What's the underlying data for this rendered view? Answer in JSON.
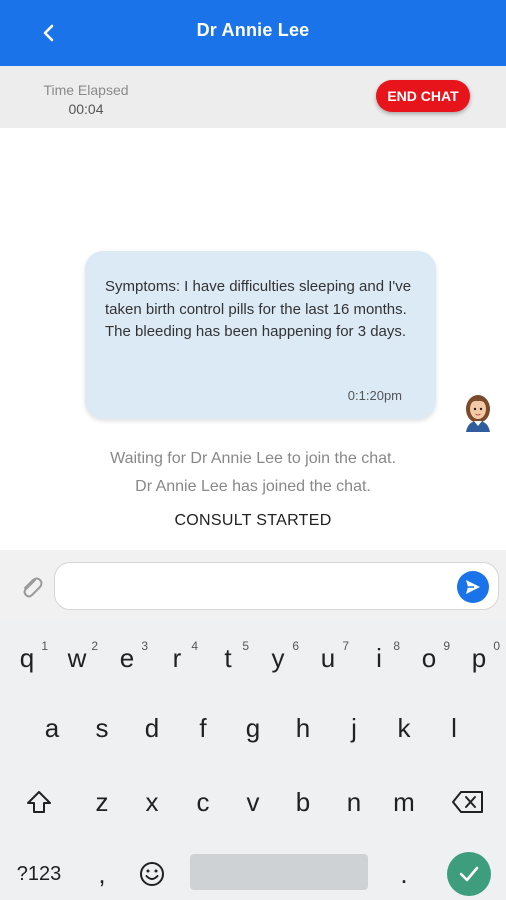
{
  "header": {
    "title": "Dr Annie Lee"
  },
  "timer": {
    "label": "Time Elapsed",
    "value": "00:04",
    "end_chat_label": "END CHAT"
  },
  "chat": {
    "bubble_text": "Symptoms: I have difficulties sleeping and I've taken birth control pills for the last 16 months. The bleeding has been happening for 3 days.",
    "bubble_time": "0:1:20pm",
    "system_messages": [
      "Waiting for Dr Annie Lee to join the chat.",
      "Dr Annie Lee has joined the chat."
    ],
    "consult_status": "CONSULT STARTED"
  },
  "input": {
    "value": "",
    "placeholder": ""
  },
  "keyboard": {
    "row1": [
      {
        "key": "q",
        "hint": "1"
      },
      {
        "key": "w",
        "hint": "2"
      },
      {
        "key": "e",
        "hint": "3"
      },
      {
        "key": "r",
        "hint": "4"
      },
      {
        "key": "t",
        "hint": "5"
      },
      {
        "key": "y",
        "hint": "6"
      },
      {
        "key": "u",
        "hint": "7"
      },
      {
        "key": "i",
        "hint": "8"
      },
      {
        "key": "o",
        "hint": "9"
      },
      {
        "key": "p",
        "hint": "0"
      }
    ],
    "row2": [
      "a",
      "s",
      "d",
      "f",
      "g",
      "h",
      "j",
      "k",
      "l"
    ],
    "row3": [
      "z",
      "x",
      "c",
      "v",
      "b",
      "n",
      "m"
    ],
    "symbols_label": "?123",
    "comma": ",",
    "period": "."
  },
  "colors": {
    "header": "#1a73e8",
    "end_chat": "#e8141b",
    "bubble": "#dceaf6",
    "enter": "#3d9d7c"
  }
}
